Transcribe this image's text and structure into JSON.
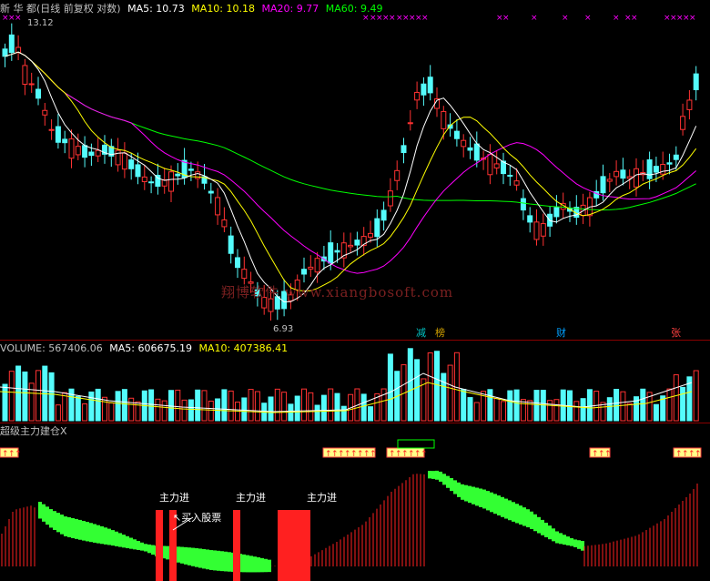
{
  "header": {
    "name": "新 华 都(日线 前复权 对数)",
    "ma5": "MA5: 10.73",
    "ma10": "MA10: 10.18",
    "ma20": "MA20: 9.77",
    "ma60": "MA60: 9.49"
  },
  "price": {
    "high_label": "13.12",
    "low_label": "6.93"
  },
  "watermark": "翔博软件  www.xiangbosoft.com",
  "event_marks": [
    {
      "text": "减",
      "color": "#00c0c0"
    },
    {
      "text": "榜",
      "color": "#d0a000"
    },
    {
      "text": "财",
      "color": "#00a0ff"
    },
    {
      "text": "张",
      "color": "#ff4040"
    }
  ],
  "volume": {
    "volume": "VOLUME: 567406.06",
    "ma5": "MA5: 606675.19",
    "ma10": "MA10: 407386.41"
  },
  "indicator": {
    "title": "超级主力建仓X",
    "labels": [
      "主力进",
      "主力进",
      "主力进"
    ],
    "buy_label": "↖买入股票"
  },
  "colors": {
    "up": "#ff3232",
    "down": "#54fcfc",
    "ma5": "#ffffff",
    "ma10": "#ffff00",
    "ma20": "#ff00ff",
    "ma60": "#00ff00",
    "separator": "#8a0000"
  }
}
